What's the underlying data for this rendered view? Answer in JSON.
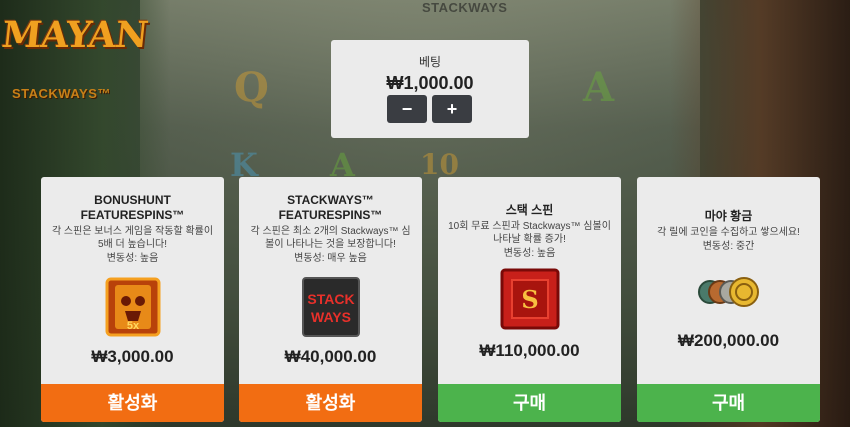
{
  "game": {
    "logo_title": "MAYAN",
    "logo_subtitle": "STACKWAYS™",
    "top_title": "STACKWAYS"
  },
  "background_symbols": [
    "Q",
    "A",
    "K",
    "A",
    "10"
  ],
  "bet": {
    "label": "베팅",
    "value": "₩1,000.00",
    "minus": "−",
    "plus": "+"
  },
  "cards": [
    {
      "title": "BONUSHUNT FEATURESPINS™",
      "description": "각 스핀은 보너스 게임을 작동할 확률이 5배 더 높습니다!",
      "volatility": "변동성: 높음",
      "icon": "bonushunt-skull-5x-icon",
      "icon_text": "5x",
      "price": "₩3,000.00",
      "button": "활성화",
      "button_color": "#f26d12"
    },
    {
      "title": "STACKWAYS™ FEATURESPINS™",
      "description": "각 스핀은 최소 2개의 Stackways™ 심볼이 나타나는 것을 보장합니다!",
      "volatility": "변동성: 매우 높음",
      "icon": "stackways-logo-icon",
      "icon_text": "STACK WAYS",
      "price": "₩40,000.00",
      "button": "활성화",
      "button_color": "#f26d12"
    },
    {
      "title": "스택 스핀",
      "description": "10회 무료 스핀과 Stackways™ 심볼이 나타날 확률 증가!",
      "volatility": "변동성: 높음",
      "icon": "red-s-block-icon",
      "icon_text": "S",
      "price": "₩110,000.00",
      "button": "구매",
      "button_color": "#4cb34c"
    },
    {
      "title": "마야 황금",
      "description": "각 릴에 코인을 수집하고 쌓으세요!",
      "volatility": "변동성: 중간",
      "icon": "gold-coins-icon",
      "price": "₩200,000.00",
      "button": "구매",
      "button_color": "#4cb34c"
    }
  ]
}
